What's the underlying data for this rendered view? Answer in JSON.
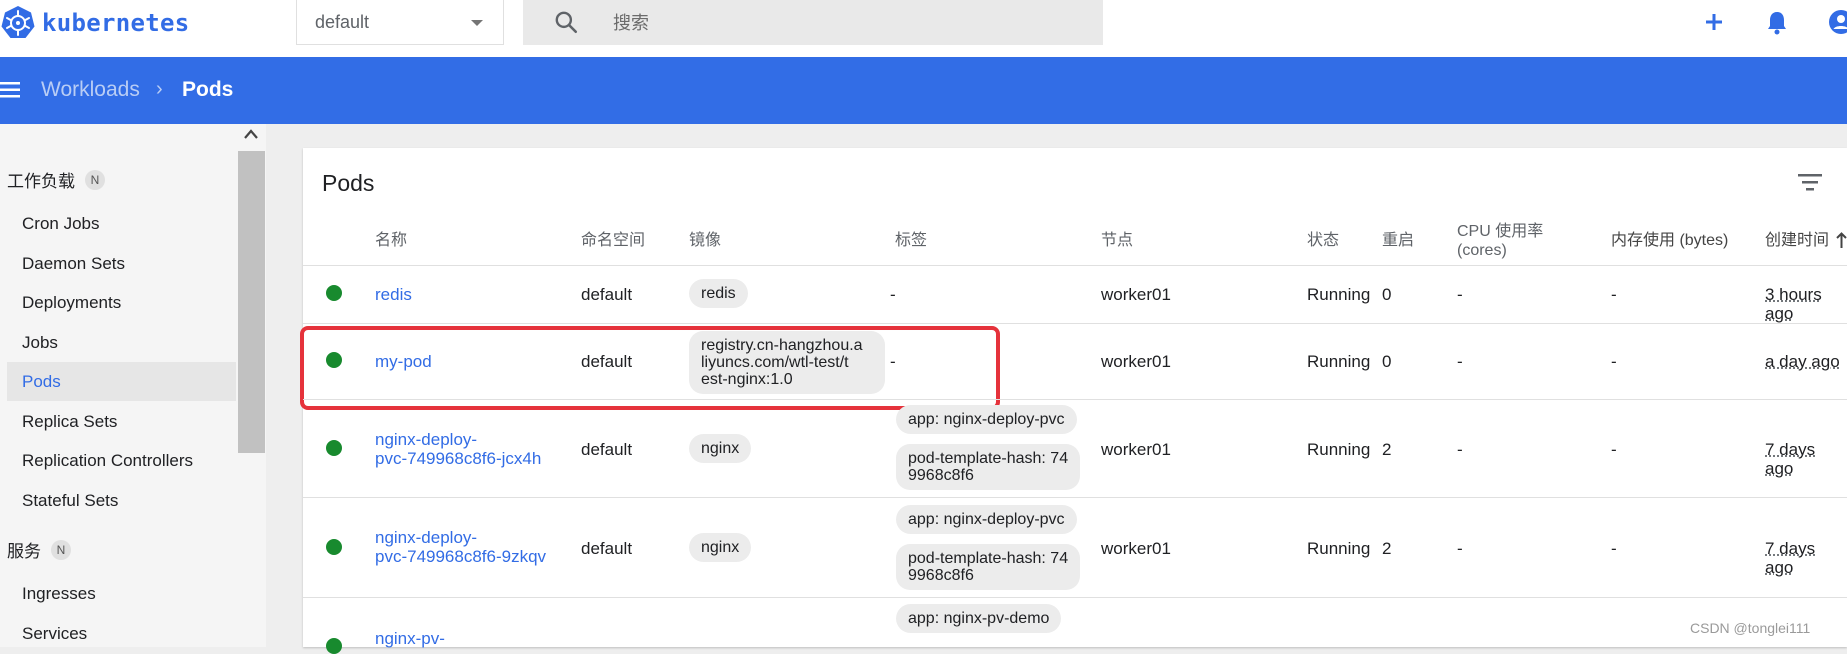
{
  "app": {
    "logo_text": "kubernetes"
  },
  "header": {
    "namespace": "default",
    "search_placeholder": "搜索",
    "icons": [
      "plus-icon",
      "bell-icon",
      "account-icon"
    ]
  },
  "breadcrumb": {
    "parent": "Workloads",
    "separator": "›",
    "current": "Pods"
  },
  "sidebar": {
    "sections": [
      {
        "label": "工作负载",
        "badge": "N"
      },
      {
        "label": "服务",
        "badge": "N"
      }
    ],
    "workload_items": [
      "Cron Jobs",
      "Daemon Sets",
      "Deployments",
      "Jobs",
      "Pods",
      "Replica Sets",
      "Replication Controllers",
      "Stateful Sets"
    ],
    "service_items": [
      "Ingresses",
      "Services"
    ],
    "active": "Pods"
  },
  "card": {
    "title": "Pods"
  },
  "table": {
    "columns": [
      "名称",
      "命名空间",
      "镜像",
      "标签",
      "节点",
      "状态",
      "重启",
      "CPU 使用率",
      "(cores)",
      "内存使用 (bytes)",
      "创建时间"
    ],
    "rows": [
      {
        "name": "redis",
        "namespace": "default",
        "image": "redis",
        "labels": [
          "-"
        ],
        "node": "worker01",
        "status": "Running",
        "restarts": "0",
        "cpu": "-",
        "memory": "-",
        "age": "3 hours ago"
      },
      {
        "name": "my-pod",
        "namespace": "default",
        "image_lines": [
          "registry.cn-hangzhou.a",
          "liyuncs.com/wtl-test/t",
          "est-nginx:1.0"
        ],
        "labels": [
          "-"
        ],
        "node": "worker01",
        "status": "Running",
        "restarts": "0",
        "cpu": "-",
        "memory": "-",
        "age": "a day ago"
      },
      {
        "name_lines": [
          "nginx-deploy-",
          "pvc-749968c8f6-jcx4h"
        ],
        "namespace": "default",
        "image": "nginx",
        "labels": [
          "app: nginx-deploy-pvc"
        ],
        "label_hash": [
          "pod-template-hash: 74",
          "9968c8f6"
        ],
        "node": "worker01",
        "status": "Running",
        "restarts": "2",
        "cpu": "-",
        "memory": "-",
        "age": "7 days ago"
      },
      {
        "name_lines": [
          "nginx-deploy-",
          "pvc-749968c8f6-9zkqv"
        ],
        "namespace": "default",
        "image": "nginx",
        "labels": [
          "app: nginx-deploy-pvc"
        ],
        "label_hash": [
          "pod-template-hash: 74",
          "9968c8f6"
        ],
        "node": "worker01",
        "status": "Running",
        "restarts": "2",
        "cpu": "-",
        "memory": "-",
        "age": "7 days ago"
      },
      {
        "name_lines": [
          "nginx-pv-"
        ],
        "labels": [
          "app: nginx-pv-demo"
        ]
      }
    ]
  },
  "watermark": "CSDN @tonglei111",
  "colors": {
    "brand": "#326ce5",
    "header_bar": "#326de6",
    "status_ok": "#188a2e",
    "highlight": "#e5323b"
  }
}
